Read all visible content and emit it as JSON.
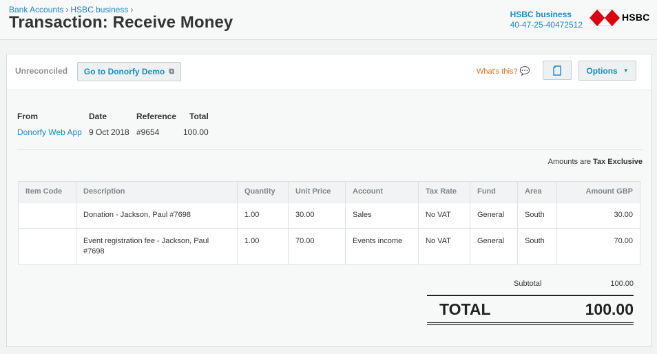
{
  "breadcrumb": {
    "items": [
      "Bank Accounts",
      "HSBC business"
    ],
    "separator": "›"
  },
  "page": {
    "title": "Transaction: Receive Money"
  },
  "bank": {
    "name": "HSBC business",
    "account": "40-47-25-40472512"
  },
  "logo": {
    "text": "HSBC",
    "icon": "hsbc-hexagon-icon",
    "color": "#db0011"
  },
  "toolbar": {
    "status": "Unreconciled",
    "goto_label": "Go to Donorfy Demo",
    "goto_icon": "external-link-icon",
    "whats_this": "What's this?",
    "whats_icon": "speech-bubble-icon",
    "copy_icon": "copy-document-icon",
    "options_label": "Options",
    "options_icon": "caret-down-icon"
  },
  "details": {
    "from_label": "From",
    "from_value": "Donorfy Web App",
    "date_label": "Date",
    "date_value": "9 Oct 2018",
    "reference_label": "Reference",
    "reference_value": "#9654",
    "total_label": "Total",
    "total_value": "100.00"
  },
  "amounts_note": {
    "prefix": "Amounts are",
    "mode": "Tax Exclusive"
  },
  "table": {
    "columns": [
      "Item Code",
      "Description",
      "Quantity",
      "Unit Price",
      "Account",
      "Tax Rate",
      "Fund",
      "Area",
      "Amount GBP"
    ],
    "rows": [
      [
        "",
        "Donation - Jackson, Paul #7698",
        "1.00",
        "30.00",
        "Sales",
        "No VAT",
        "General",
        "South",
        "30.00"
      ],
      [
        "",
        "Event registration fee - Jackson, Paul #7698",
        "1.00",
        "70.00",
        "Events income",
        "No VAT",
        "General",
        "South",
        "70.00"
      ]
    ]
  },
  "totals": {
    "subtotal_label": "Subtotal",
    "subtotal_value": "100.00",
    "total_label": "TOTAL",
    "total_value": "100.00"
  },
  "colors": {
    "link": "#1e88bf",
    "accent_orange": "#e06d1c",
    "hsbc_red": "#db0011"
  }
}
